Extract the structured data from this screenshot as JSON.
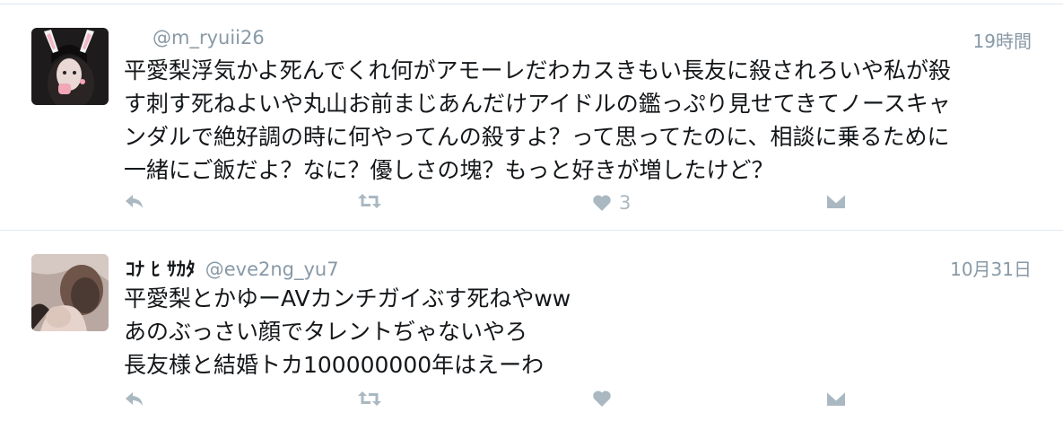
{
  "colors": {
    "icon": "#aab8c2",
    "handle": "#8899a6",
    "text": "#14171a",
    "divider": "#e1e8ed"
  },
  "tweets": [
    {
      "display_name": "",
      "handle": "@m_ryuii26",
      "timestamp": "19時間",
      "lines": [
        "平愛梨浮気かよ死んでくれ何がアモーレだわカスきもい長友に殺されろいや私が殺",
        "す刺す死ねよいや丸山お前まじあんだけアイドルの鑑っぷり見せてきてノースキャ",
        "ンダルで絶好調の時に何やってんの殺すよ？って思ってたのに、相談に乗るために",
        "一緒にご飯だよ？なに？優しさの塊？もっと好きが増したけど？"
      ],
      "like_count": "3",
      "icons": {
        "reply": "reply-icon",
        "retweet": "retweet-icon",
        "like": "heart-icon",
        "dm": "envelope-icon"
      }
    },
    {
      "display_name": "ｺﾅ ﾋ ｻｶﾀ",
      "handle": "@eve2ng_yu7",
      "timestamp": "10月31日",
      "lines": [
        "平愛梨とかゆーAVカンチガイぶす死ねやww",
        "あのぶっさい顔でタレントぢゃないやろ",
        "長友様と結婚トカ100000000年はえーわ"
      ],
      "like_count": "",
      "icons": {
        "reply": "reply-icon",
        "retweet": "retweet-icon",
        "like": "heart-icon",
        "dm": "envelope-icon"
      }
    }
  ]
}
